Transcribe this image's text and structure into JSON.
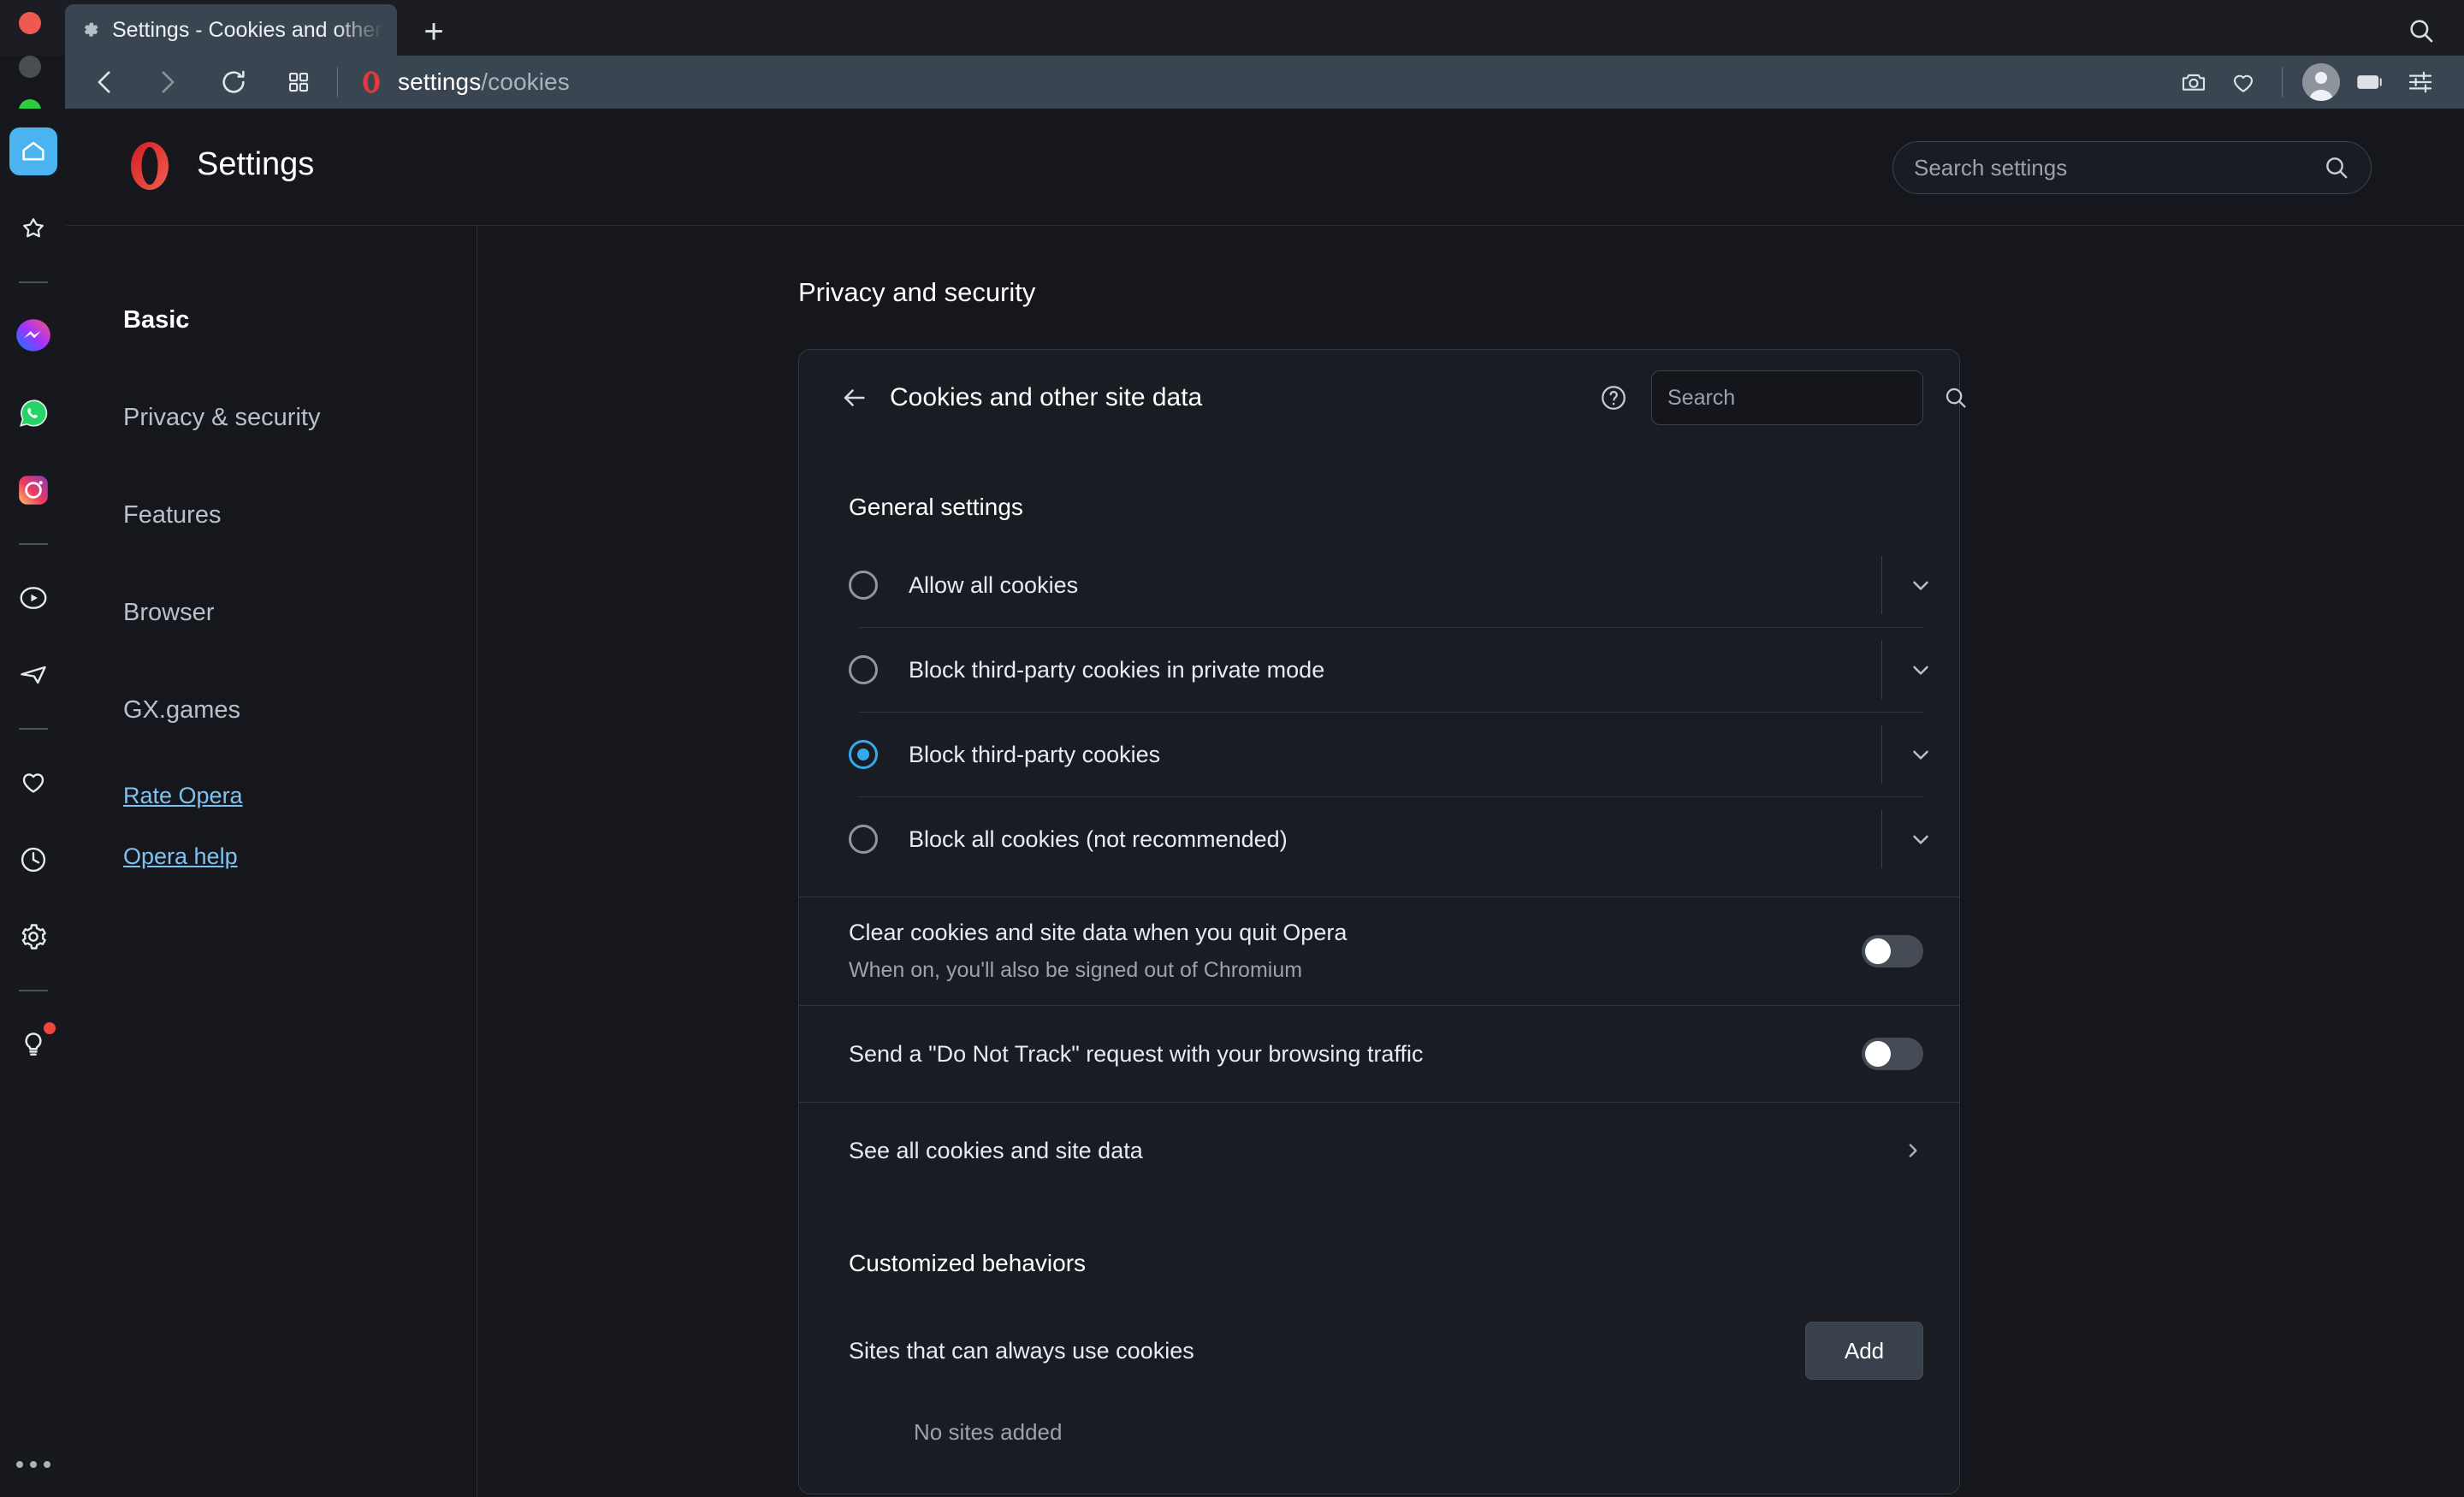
{
  "browser": {
    "tab": {
      "title": "Settings - Cookies and other sit",
      "favicon_icon": "gear-icon"
    },
    "new_tab_label": "+",
    "toolbar": {
      "back_icon": "chevron-left-icon",
      "forward_icon": "chevron-right-icon",
      "reload_icon": "reload-icon",
      "speeddial_icon": "grid-icon",
      "site_favicon": "opera-logo-icon",
      "address_main": "settings",
      "address_path": "/cookies",
      "snapshot_icon": "camera-icon",
      "favorites_icon": "heart-icon",
      "profile_icon": "avatar-icon",
      "tab_island_icon": "battery-icon",
      "easy_setup_icon": "sliders-icon"
    },
    "titlebar_search_icon": "search-icon"
  },
  "sidebar": {
    "items": [
      {
        "name": "home",
        "icon": "home-icon",
        "active": true
      },
      {
        "name": "speed-dial",
        "icon": "star-icon",
        "active": false
      },
      {
        "name": "messenger",
        "icon": "messenger-icon",
        "active": false
      },
      {
        "name": "whatsapp",
        "icon": "whatsapp-icon",
        "active": false
      },
      {
        "name": "instagram",
        "icon": "instagram-icon",
        "active": false
      },
      {
        "name": "player",
        "icon": "play-circle-icon",
        "active": false
      },
      {
        "name": "telegram",
        "icon": "send-icon",
        "active": false
      },
      {
        "name": "favorites",
        "icon": "heart-icon",
        "active": false
      },
      {
        "name": "history",
        "icon": "clock-icon",
        "active": false
      },
      {
        "name": "settings",
        "icon": "gear-icon",
        "active": false
      },
      {
        "name": "tips",
        "icon": "lightbulb-icon",
        "active": false,
        "badge": true
      }
    ],
    "more_icon": "ellipsis-icon"
  },
  "settings_header": {
    "logo_icon": "opera-logo-icon",
    "title": "Settings",
    "search_placeholder": "Search settings",
    "search_value": "",
    "search_icon": "search-icon"
  },
  "nav": {
    "items": [
      {
        "label": "Basic",
        "selected": true
      },
      {
        "label": "Privacy & security",
        "selected": false
      },
      {
        "label": "Features",
        "selected": false
      },
      {
        "label": "Browser",
        "selected": false
      },
      {
        "label": "GX.games",
        "selected": false
      }
    ],
    "links": [
      {
        "label": "Rate Opera"
      },
      {
        "label": "Opera help"
      }
    ]
  },
  "main": {
    "section_title": "Privacy and security",
    "card": {
      "back_icon": "arrow-left-icon",
      "title": "Cookies and other site data",
      "help_icon": "help-circle-icon",
      "search_placeholder": "Search",
      "search_value": "",
      "search_icon": "search-icon",
      "general_settings_label": "General settings",
      "radio_options": [
        {
          "label": "Allow all cookies",
          "selected": false,
          "expand_icon": "chevron-down-icon"
        },
        {
          "label": "Block third-party cookies in private mode",
          "selected": false,
          "expand_icon": "chevron-down-icon"
        },
        {
          "label": "Block third-party cookies",
          "selected": true,
          "expand_icon": "chevron-down-icon"
        },
        {
          "label": "Block all cookies (not recommended)",
          "selected": false,
          "expand_icon": "chevron-down-icon"
        }
      ],
      "toggles": [
        {
          "title": "Clear cookies and site data when you quit Opera",
          "subtitle": "When on, you'll also be signed out of Chromium",
          "on": false
        },
        {
          "title": "Send a \"Do Not Track\" request with your browsing traffic",
          "subtitle": "",
          "on": false
        }
      ],
      "see_all_label": "See all cookies and site data",
      "see_all_icon": "chevron-right-icon",
      "customized_behaviors_label": "Customized behaviors",
      "always_allow_label": "Sites that can always use cookies",
      "add_button_label": "Add",
      "no_sites_label": "No sites added"
    }
  },
  "colors": {
    "accent_blue": "#36a9ee",
    "page_bg": "#15171c",
    "chrome_bg": "#3a4552",
    "card_bg": "#191c22",
    "opera_red": "#e0272b",
    "link_blue": "#7fc2f0"
  }
}
